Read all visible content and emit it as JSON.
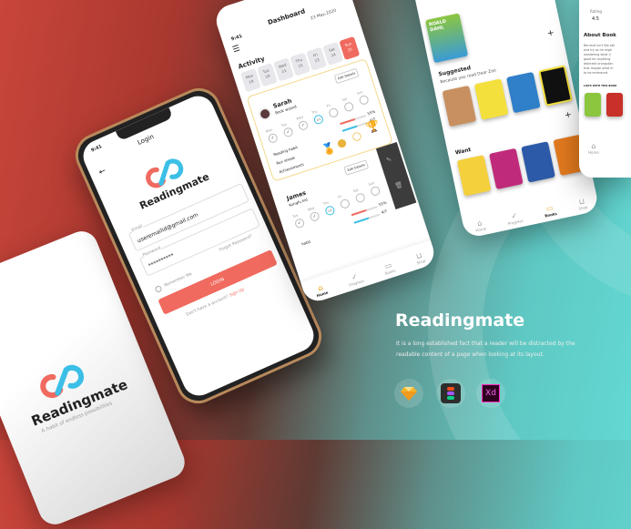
{
  "brand": {
    "name": "Readingmate",
    "tagline": "A habit of endless possibilities",
    "description_line1": "It is a long established fact that a reader will be distracted by the",
    "description_line2": "readable content of a page when looking at its layout."
  },
  "tools": [
    {
      "icon": "sketch-icon",
      "label": ""
    },
    {
      "icon": "figma-icon",
      "label": ""
    },
    {
      "icon": "xd-icon",
      "label": "Xd"
    }
  ],
  "login": {
    "time": "9:41",
    "title": "Login",
    "email_label": "Email",
    "email_value": "useremailid@gmail.com",
    "password_label": "Password",
    "password_value": "**********",
    "forgot": "Forgot Password?",
    "remember": "Remember Me",
    "login_button": "LOGIN",
    "no_account": "Don't have a account?",
    "sign_up": "Sign Up"
  },
  "dashboard": {
    "time": "9:41",
    "title": "Dashboard",
    "date": "23 May,2020",
    "activity": "Activity",
    "days": [
      {
        "d": "Mon",
        "n": "19"
      },
      {
        "d": "Tue",
        "n": "20"
      },
      {
        "d": "Wed",
        "n": "21"
      },
      {
        "d": "Thu",
        "n": "22"
      },
      {
        "d": "Fri",
        "n": "23"
      },
      {
        "d": "Sat",
        "n": "24"
      },
      {
        "d": "Sun",
        "n": "25"
      }
    ],
    "edit": "Edit Details",
    "week": [
      "Mon",
      "Tue",
      "Wed",
      "Thu",
      "Fri",
      "Sat",
      "Sun"
    ],
    "sarah": {
      "name": "Sarah",
      "role": "Book wizard",
      "progress": "55%",
      "streak": "4/7",
      "reading_habit": "Reading habit",
      "run_streak": "Run streak",
      "achievements": "Achievements",
      "thu": "1/2"
    },
    "james": {
      "name": "James",
      "role": "Kungfu kid",
      "progress": "55%",
      "streak": "4/7",
      "habit": "habit",
      "thu": "1/2"
    },
    "nav": [
      "Home",
      "Progress",
      "Books",
      "Shop"
    ]
  },
  "books": {
    "suggested": "Suggested",
    "because": "Because you read Dear Zoo",
    "want": "Want",
    "nav": [
      "Home",
      "Progress",
      "Books",
      "Shop"
    ],
    "covers": [
      "ROALD DAHL"
    ]
  },
  "detail": {
    "rating_label": "Rating",
    "rating_value": "4.5",
    "about": "About Book",
    "about_text": [
      "Bernard isn't like oth",
      "and try as he migh",
      "wondering what h",
      "good for anything",
      "dejected orangutan",
      "that maybe what m",
      "to be embraced."
    ],
    "lists": "LISTS WITH THIS BOOK",
    "nav_home": "Home"
  },
  "colors": {
    "accent": "#f06a5f",
    "blue": "#3cbfe6",
    "gold": "#e8b43c"
  }
}
